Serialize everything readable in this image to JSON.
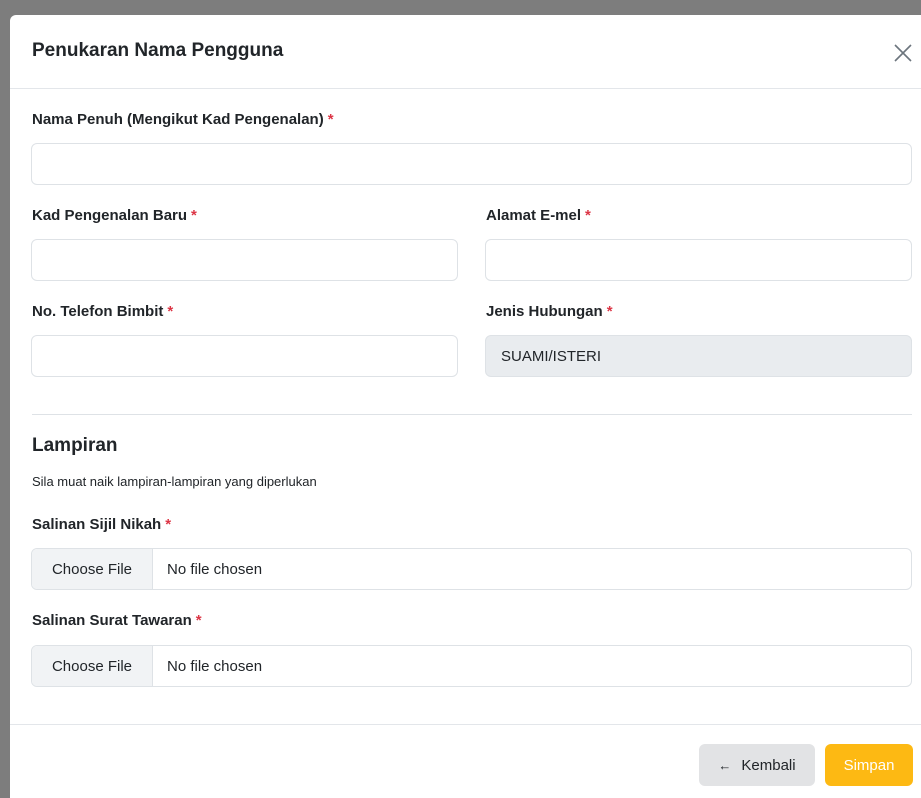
{
  "modal": {
    "title": "Penukaran Nama Pengguna"
  },
  "form": {
    "full_name": {
      "label": "Nama Penuh (Mengikut Kad Pengenalan)",
      "value": "",
      "placeholder": ""
    },
    "ic_new": {
      "label": "Kad Pengenalan Baru",
      "value": "",
      "placeholder": ""
    },
    "email": {
      "label": "Alamat E-mel",
      "value": "",
      "placeholder": ""
    },
    "phone": {
      "label": "No. Telefon Bimbit",
      "value": "",
      "placeholder": ""
    },
    "relationship": {
      "label": "Jenis Hubungan",
      "value": "SUAMI/ISTERI"
    },
    "required_mark": "*"
  },
  "attachments": {
    "title": "Lampiran",
    "subtitle": "Sila muat naik lampiran-lampiran yang diperlukan",
    "files": [
      {
        "label": "Salinan Sijil Nikah",
        "button": "Choose File",
        "status": "No file chosen"
      },
      {
        "label": "Salinan Surat Tawaran",
        "button": "Choose File",
        "status": "No file chosen"
      }
    ]
  },
  "footer": {
    "back_label": "Kembali",
    "save_label": "Simpan",
    "back_icon": "arrow-left-icon"
  },
  "colors": {
    "accent": "#fdb913",
    "required": "#dc3545",
    "readonly_bg": "#e9ecef"
  }
}
